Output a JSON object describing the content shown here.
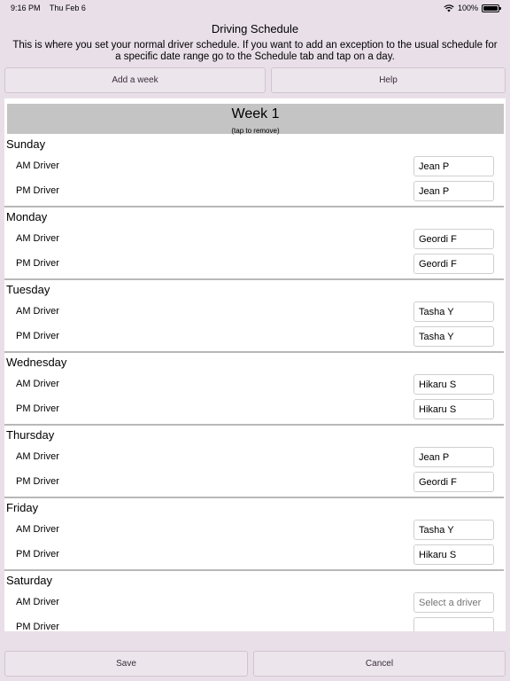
{
  "status_bar": {
    "time": "9:16 PM",
    "date": "Thu Feb 6",
    "battery": "100%",
    "battery_level": 1.0
  },
  "header": {
    "title": "Driving Schedule",
    "description": "This is where you set your normal driver schedule.  If you want to add an exception to the usual schedule for a specific date range go to the Schedule tab and tap on a day."
  },
  "toolbar": {
    "add_week_label": "Add a week",
    "help_label": "Help"
  },
  "week": {
    "title": "Week 1",
    "hint": "(tap to remove)",
    "days": [
      {
        "name": "Sunday",
        "am_label": "AM Driver",
        "am_value": "Jean P",
        "pm_label": "PM Driver",
        "pm_value": "Jean P"
      },
      {
        "name": "Monday",
        "am_label": "AM Driver",
        "am_value": "Geordi F",
        "pm_label": "PM Driver",
        "pm_value": "Geordi F"
      },
      {
        "name": "Tuesday",
        "am_label": "AM Driver",
        "am_value": "Tasha Y",
        "pm_label": "PM Driver",
        "pm_value": "Tasha Y"
      },
      {
        "name": "Wednesday",
        "am_label": "AM Driver",
        "am_value": "Hikaru S",
        "pm_label": "PM Driver",
        "pm_value": "Hikaru S"
      },
      {
        "name": "Thursday",
        "am_label": "AM Driver",
        "am_value": "Jean P",
        "pm_label": "PM Driver",
        "pm_value": "Geordi F"
      },
      {
        "name": "Friday",
        "am_label": "AM Driver",
        "am_value": "Tasha Y",
        "pm_label": "PM Driver",
        "pm_value": "Hikaru S"
      },
      {
        "name": "Saturday",
        "am_label": "AM Driver",
        "am_value": "",
        "am_placeholder": "Select a driver",
        "pm_label": "PM Driver",
        "pm_value": ""
      }
    ]
  },
  "footer": {
    "save_label": "Save",
    "cancel_label": "Cancel"
  },
  "colors": {
    "background": "#e8dfe8",
    "week_header": "#c4c4c4",
    "button": "#ece6ec"
  }
}
